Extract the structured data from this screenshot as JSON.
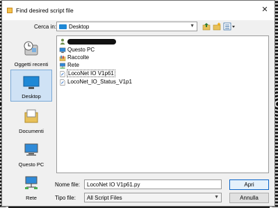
{
  "window": {
    "title": "Find desired script file",
    "close_glyph": "✕"
  },
  "lookin": {
    "label": "Cerca in:",
    "value": "Desktop"
  },
  "places": [
    {
      "id": "recent",
      "label": "Oggetti recenti",
      "icon": "recent-items-icon"
    },
    {
      "id": "desktop",
      "label": "Desktop",
      "icon": "desktop-icon",
      "active": true
    },
    {
      "id": "documents",
      "label": "Documenti",
      "icon": "documents-icon"
    },
    {
      "id": "thispc",
      "label": "Questo PC",
      "icon": "computer-icon"
    },
    {
      "id": "network",
      "label": "Rete",
      "icon": "network-icon"
    }
  ],
  "files": [
    {
      "name": "",
      "icon": "user-folder-icon",
      "redacted": true
    },
    {
      "name": "Questo PC",
      "icon": "computer-icon"
    },
    {
      "name": "Raccolte",
      "icon": "libraries-icon"
    },
    {
      "name": "Rete",
      "icon": "network-icon"
    },
    {
      "name": "LocoNet IO V1p61",
      "icon": "script-file-icon",
      "selected": true
    },
    {
      "name": "LocoNet_IO_Status_V1p1",
      "icon": "script-file-icon"
    }
  ],
  "filename": {
    "label": "Nome file:",
    "value": "LocoNet IO V1p61.py"
  },
  "filetype": {
    "label": "Tipo file:",
    "value": "All Script Files"
  },
  "buttons": {
    "open": "Apri",
    "cancel": "Annulla"
  },
  "colors": {
    "accent": "#1e88d6",
    "selection": "#cfe2f5",
    "primary_border": "#0a64c8"
  }
}
